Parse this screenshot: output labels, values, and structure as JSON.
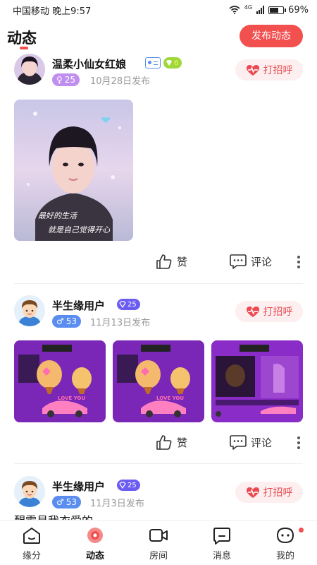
{
  "status_bar": {
    "carrier": "中国移动 晚上9:57",
    "network": "4G",
    "battery": "69%",
    "battery_level": 0.69
  },
  "header": {
    "title": "动态",
    "publish_label": "发布动态"
  },
  "posts": [
    {
      "username": "温柔小仙女红娘",
      "level": "6",
      "gender_symbol": "♀",
      "age": "25",
      "time": "10月28日发布",
      "greet_label": "打招呼",
      "photo_caption": "最好的生活 就是自己觉得开心",
      "like_label": "赞",
      "comment_label": "评论"
    },
    {
      "username": "半生缘用户",
      "level": "25",
      "gender_symbol": "♂",
      "age": "53",
      "time": "11月13日发布",
      "greet_label": "打招呼",
      "photo_caption": "LOVE YOU",
      "like_label": "赞",
      "comment_label": "评论"
    },
    {
      "username": "半生缘用户",
      "level": "25",
      "gender_symbol": "♂",
      "age": "53",
      "time": "11月3日发布",
      "greet_label": "打招呼",
      "text": "醒需易我衣爱的"
    }
  ],
  "tabs": [
    {
      "label": "缘分",
      "icon": "home-icon"
    },
    {
      "label": "动态",
      "icon": "feed-icon",
      "active": true
    },
    {
      "label": "房间",
      "icon": "video-icon"
    },
    {
      "label": "消息",
      "icon": "message-icon"
    },
    {
      "label": "我的",
      "icon": "profile-icon",
      "has_notification": true
    }
  ],
  "colors": {
    "accent": "#f24f4f",
    "female_tag": "#c08ef0",
    "male_tag": "#5a8df0",
    "level_green": "#9fd83a",
    "level_blue": "#6b5cf2"
  }
}
